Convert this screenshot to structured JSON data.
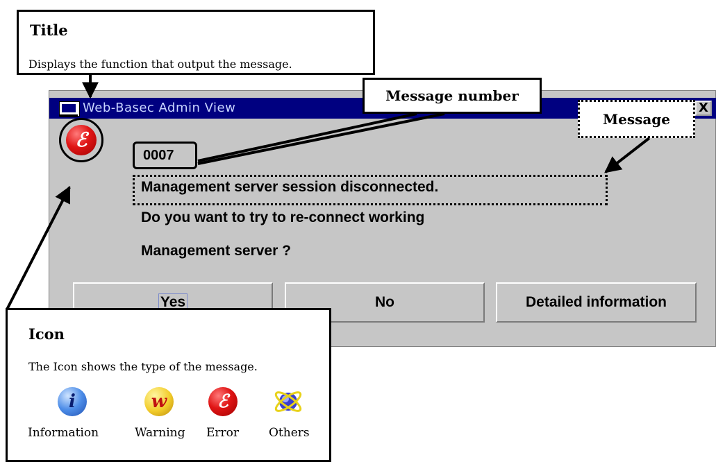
{
  "window": {
    "title": "Web-Basec Admin View",
    "close_label": "X",
    "icon": "error-icon",
    "icon_glyph": "ℰ"
  },
  "message": {
    "number": "0007",
    "lines": [
      "Management server session disconnected.",
      "Do you want to try to re-connect working",
      "Management server ?"
    ]
  },
  "buttons": {
    "yes": "Yes",
    "no": "No",
    "details": "Detailed information"
  },
  "callouts": {
    "title": {
      "heading": "Title",
      "description": "Displays the function that output the message."
    },
    "message_number": "Message number",
    "message": "Message",
    "icon": {
      "heading": "Icon",
      "description": "The Icon shows the type of the message.",
      "types": [
        {
          "label": "Information",
          "icon": "information-icon",
          "glyph": "i"
        },
        {
          "label": "Warning",
          "icon": "warning-icon",
          "glyph": "w"
        },
        {
          "label": "Error",
          "icon": "error-icon",
          "glyph": "ℰ"
        },
        {
          "label": "Others",
          "icon": "others-icon",
          "glyph": ""
        }
      ]
    }
  },
  "colors": {
    "titlebar": "#000080",
    "dialog_bg": "#c6c6c6",
    "error_red": "#e01515"
  }
}
